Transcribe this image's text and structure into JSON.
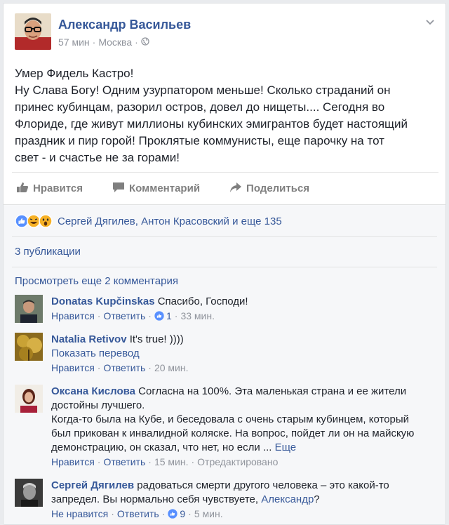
{
  "post": {
    "author": "Александр Васильев",
    "time": "57 мин",
    "location": "Москва",
    "lines": [
      "Умер Фидель Кастро!",
      "Ну Слава Богу! Одним узурпатором меньше! Сколько страданий он",
      "принес кубинцам, разорил остров, довел до нищеты.... Сегодня во",
      "Флориде, где живут миллионы кубинских эмигрантов будет настоящий",
      "праздник и пир горой! Проклятые коммунисты, еще парочку на тот",
      "свет - и счастье не за горами!"
    ]
  },
  "actions": {
    "like": "Нравится",
    "comment": "Комментарий",
    "share": "Поделиться"
  },
  "reactions_text": "Сергей Дягилев, Антон Красовский и еще 135",
  "shares_text": "3 публикации",
  "more_comments": "Просмотреть еще 2 комментария",
  "labels": {
    "like": "Нравится",
    "unlike": "Не нравится",
    "reply": "Ответить",
    "translate": "Показать перевод",
    "more": "Еще",
    "edited": "Отредактировано"
  },
  "comments": [
    {
      "author": "Donatas Kupčinskas",
      "text": "Спасибо, Господи!",
      "likes": "1",
      "time": "33 мин."
    },
    {
      "author": "Natalia Retivov",
      "text": "It's true! ))))",
      "time": "20 мин."
    },
    {
      "author": "Оксана Кислова",
      "line1": "Согласна на 100%. Эта маленькая страна и ее жители",
      "line2": "достойны лучшего.",
      "line3": "Когда-то была на Кубе, и беседовала с очень старым кубинцем, который",
      "line4": "был прикован к инвалидной коляске. На вопрос, пойдет ли он на майскую",
      "line5": "демонстрацию, он сказал, что нет, но если ...",
      "time": "15 мин."
    },
    {
      "author": "Сергей Дягилев",
      "line1": "радоваться смерти другого человека – это какой-то",
      "line2": "запредел. Вы нормально себя чувствуете,",
      "mention": "Александр",
      "line2_end": "?",
      "likes": "9",
      "time": "5 мин."
    }
  ],
  "colors": {
    "link": "#365899",
    "muted": "#90949c",
    "text": "#1d2129",
    "like_blue": "#5890ff",
    "footer_bg": "#f6f7f9"
  }
}
